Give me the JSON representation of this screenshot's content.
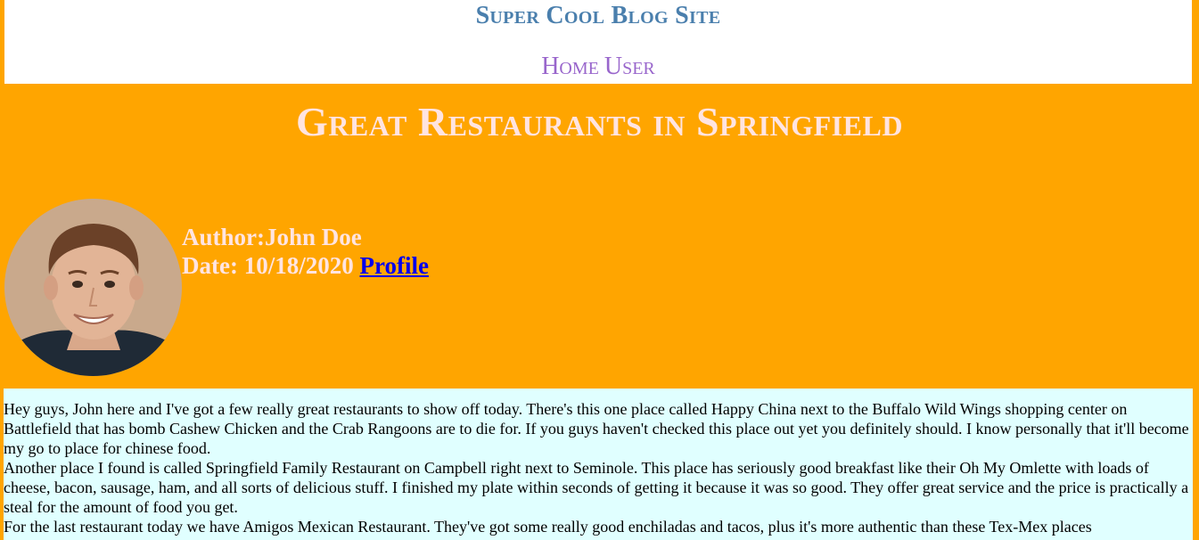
{
  "header": {
    "site_title": "Super Cool Blog Site",
    "nav": {
      "home": "Home",
      "user": "User"
    }
  },
  "post": {
    "title": "Great Restaurants in Springfield",
    "author_label": "Author:",
    "author": "John Doe",
    "date_label": "Date: ",
    "date": "10/18/2020",
    "profile_link": "Profile",
    "paragraphs": [
      "Hey guys, John here and I've got a few really great restaurants to show off today. There's this one place called Happy China next to the Buffalo Wild Wings shopping center on Battlefield that has bomb Cashew Chicken and the Crab Rangoons are to die for. If you guys haven't checked this place out yet you definitely should. I know personally that it'll become my go to place for chinese food.",
      "Another place I found is called Springfield Family Restaurant on Campbell right next to Seminole. This place has seriously good breakfast like their Oh My Omlette with loads of cheese, bacon, sausage, ham, and all sorts of delicious stuff. I finished my plate within seconds of getting it because it was so good. They offer great service and the price is practically a steal for the amount of food you get.",
      "For the last restaurant today we have Amigos Mexican Restaurant. They've got some really good enchiladas and tacos, plus it's more authentic than these Tex-Mex places"
    ]
  },
  "colors": {
    "page_bg": "#ffa500",
    "header_bg": "#ffffff",
    "site_title": "#4a7fad",
    "nav": "#9966cc",
    "post_title": "#ffe4e1",
    "content_bg": "#e0ffff",
    "link": "#0000ee"
  }
}
